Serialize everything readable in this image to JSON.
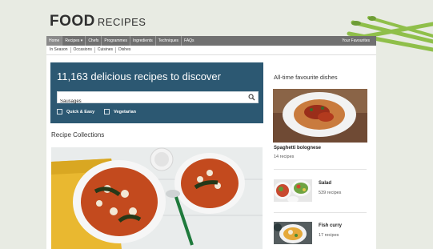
{
  "header": {
    "logo_food": "FOOD",
    "logo_recipes": "RECIPES"
  },
  "nav": {
    "items": [
      "Home",
      "Recipes ▾",
      "Chefs",
      "Programmes",
      "Ingredients",
      "Techniques",
      "FAQs"
    ],
    "favourites": "Your Favourites"
  },
  "subnav": {
    "items": [
      "In Season",
      "Occasions",
      "Cuisines",
      "Dishes"
    ]
  },
  "hero": {
    "title": "11,163 delicious recipes to discover",
    "search_value": "Sausages",
    "filters": [
      "Quick & Easy",
      "Vegetarian"
    ]
  },
  "main": {
    "collections_title": "Recipe Collections"
  },
  "sidebar": {
    "title": "All-time favourite dishes",
    "featured": {
      "name": "Spaghetti bolognese",
      "count": "14 recipes"
    },
    "items": [
      {
        "name": "Salad",
        "count": "539 recipes"
      },
      {
        "name": "Fish curry",
        "count": "17 recipes"
      }
    ]
  },
  "colors": {
    "hero_bg": "#2c5872",
    "nav_bg": "#707070",
    "page_bg": "#e8ebe3"
  }
}
